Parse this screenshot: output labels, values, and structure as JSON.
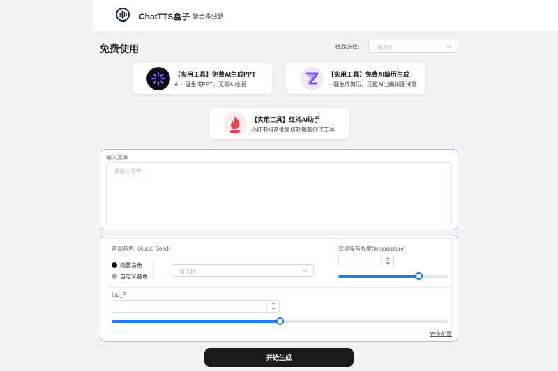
{
  "header": {
    "brand": "ChatTTS盒子",
    "brand_sub": "聚合多线路"
  },
  "page": {
    "title": "免费使用"
  },
  "route": {
    "label": "线路选择:",
    "placeholder": "请选择"
  },
  "cards": [
    {
      "title": "【实用工具】免费AI生成PPT",
      "desc": "AI一键生成PPT，无限AI绘图",
      "icon": "ppt-ai-icon",
      "color": "#7b5cf5"
    },
    {
      "title": "【实用工具】免费AI简历生成",
      "desc": "一键生成简历，还能AI出模拟面试题",
      "icon": "resume-ai-icon",
      "color": "#7a52f0"
    },
    {
      "title": "【实用工具】红抖AI助手",
      "desc": "小红书抖音批量仿制爆款创作工具",
      "icon": "flame-icon",
      "color": "#e9424f"
    }
  ],
  "input": {
    "label": "输入文本",
    "placeholder": "请输入文字..."
  },
  "audio": {
    "seed_label": "音调音色（Audio Seed)",
    "option_builtin": "内置音色",
    "option_custom": "自定义音色",
    "select_placeholder": "请选择",
    "temperature_label": "背景噪音强度(temperature)",
    "temperature_level": 0.73,
    "top_p_label": "top_P",
    "top_p_level": 0.5
  },
  "more_config": "更多配置",
  "start_button": "开始生成",
  "colors": {
    "accent": "#1f7ff0",
    "border": "#b9b5dc",
    "button": "#1a1a1a"
  }
}
